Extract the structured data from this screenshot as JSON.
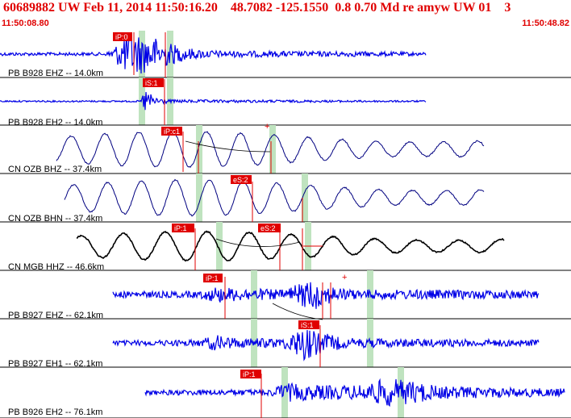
{
  "header": {
    "title": "60689882 UW Feb 11, 2014 11:50:16.20    48.7082 -125.1550  0.8 0.70 Md re amyw UW 01    3",
    "time_start": "11:50:08.80",
    "time_end": "11:50:48.82"
  },
  "colors": {
    "title": "#e00000",
    "trace_blue": "#0000e6",
    "trace_black": "#000000",
    "pick_red": "#e00000",
    "window_green": "#bfe3bf",
    "background": "#ffffff"
  },
  "traces": [
    {
      "label": "PB B928 EHZ -- 14.0km",
      "color": "blue",
      "picks": [
        {
          "text": "iP:0",
          "sign": "-"
        }
      ],
      "envelope": [
        [
          0,
          2
        ],
        [
          25,
          2
        ],
        [
          27,
          10
        ],
        [
          30,
          28
        ],
        [
          34,
          24
        ],
        [
          38,
          18
        ],
        [
          42,
          10
        ],
        [
          46,
          6
        ],
        [
          52,
          4
        ],
        [
          90,
          3
        ],
        [
          100,
          2
        ]
      ]
    },
    {
      "label": "PB B928 EH2 -- 14.0km",
      "color": "blue",
      "picks": [
        {
          "text": "iS:1",
          "sign": ""
        }
      ],
      "envelope": [
        [
          0,
          1
        ],
        [
          33,
          1
        ],
        [
          34,
          16
        ],
        [
          36,
          6
        ],
        [
          40,
          2
        ],
        [
          100,
          1
        ]
      ]
    },
    {
      "label": "CN OZB BHZ -- 37.4km",
      "color": "navy",
      "picks": [
        {
          "text": "iP:c1",
          "sign": ""
        },
        {
          "text": "",
          "sign": "+"
        }
      ],
      "envelope": []
    },
    {
      "label": "CN OZB BHN -- 37.4km",
      "color": "navy",
      "picks": [
        {
          "text": "eS:2",
          "sign": ""
        }
      ],
      "envelope": []
    },
    {
      "label": "CN MGB HHZ -- 46.6km",
      "color": "black",
      "picks": [
        {
          "text": "iP:1",
          "sign": ""
        },
        {
          "text": "eS:2",
          "sign": ""
        }
      ],
      "envelope": []
    },
    {
      "label": "PB B927 EHZ -- 62.1km",
      "color": "blue",
      "picks": [
        {
          "text": "iP:1",
          "sign": ""
        },
        {
          "text": "",
          "sign": "+"
        }
      ],
      "envelope": [
        [
          0,
          4
        ],
        [
          20,
          4
        ],
        [
          24,
          10
        ],
        [
          30,
          8
        ],
        [
          40,
          6
        ],
        [
          47,
          20
        ],
        [
          50,
          12
        ],
        [
          56,
          6
        ],
        [
          70,
          6
        ],
        [
          100,
          5
        ]
      ]
    },
    {
      "label": "PB B927 EH1 -- 62.1km",
      "color": "blue",
      "picks": [
        {
          "text": "iS:1",
          "sign": ""
        }
      ],
      "envelope": [
        [
          0,
          3
        ],
        [
          20,
          4
        ],
        [
          24,
          10
        ],
        [
          30,
          6
        ],
        [
          40,
          6
        ],
        [
          45,
          22
        ],
        [
          48,
          14
        ],
        [
          55,
          6
        ],
        [
          70,
          5
        ],
        [
          100,
          4
        ]
      ]
    },
    {
      "label": "PB B926 EH2 -- 76.1km",
      "color": "blue",
      "picks": [
        {
          "text": "iP:1",
          "sign": ""
        }
      ],
      "envelope": [
        [
          0,
          3
        ],
        [
          30,
          4
        ],
        [
          33,
          12
        ],
        [
          40,
          9
        ],
        [
          50,
          9
        ],
        [
          58,
          18
        ],
        [
          64,
          14
        ],
        [
          70,
          8
        ],
        [
          85,
          6
        ],
        [
          100,
          5
        ]
      ]
    }
  ]
}
